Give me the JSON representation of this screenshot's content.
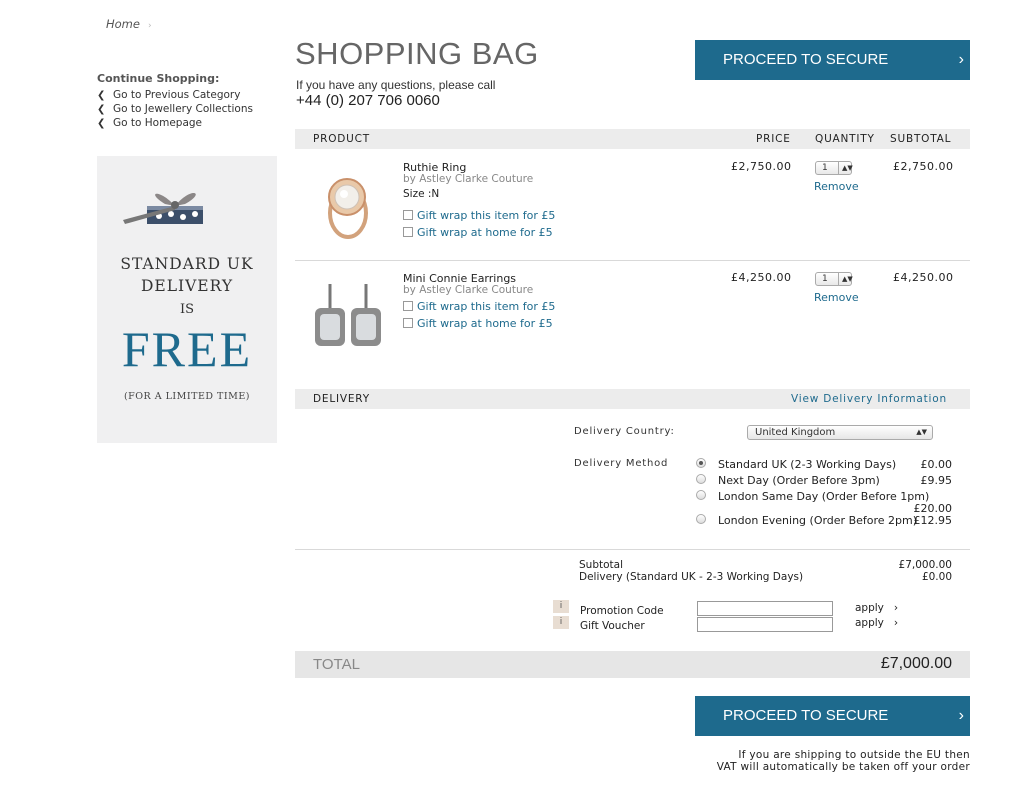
{
  "breadcrumb": {
    "home": "Home",
    "sep": "›"
  },
  "sidebar": {
    "title": "Continue Shopping:",
    "links": [
      "Go to Previous Category",
      "Go to Jewellery Collections",
      "Go to Homepage"
    ],
    "promo": {
      "line1": "STANDARD UK",
      "line2": "DELIVERY",
      "line3": "IS",
      "big": "FREE",
      "note": "(FOR A LIMITED TIME)",
      "image_icon": "gift-box-icon"
    }
  },
  "header": {
    "title": "SHOPPING BAG",
    "question": "If you have any questions, please call",
    "phone": "+44 (0) 207 706 0060",
    "checkout_label": "PROCEED TO SECURE CHECKOUT",
    "checkout_arrow": "›"
  },
  "table": {
    "headers": {
      "product": "PRODUCT",
      "price": "PRICE",
      "quantity": "QUANTITY",
      "subtotal": "SUBTOTAL"
    },
    "items": [
      {
        "name": "Ruthie Ring",
        "brand": "by Astley Clarke Couture",
        "size": "Size :N",
        "gift_item": "Gift wrap this item for £5",
        "gift_home": "Gift wrap at home for £5",
        "price": "£2,750.00",
        "qty": "1",
        "remove": "Remove",
        "subtotal": "£2,750.00"
      },
      {
        "name": "Mini Connie Earrings",
        "brand": "by Astley Clarke Couture",
        "gift_item": "Gift wrap this item for £5",
        "gift_home": "Gift wrap at home for £5",
        "price": "£4,250.00",
        "qty": "1",
        "remove": "Remove",
        "subtotal": "£4,250.00"
      }
    ]
  },
  "delivery": {
    "header": "DELIVERY",
    "info_link": "View Delivery Information",
    "country_label": "Delivery Country:",
    "country_value": "United Kingdom",
    "method_label": "Delivery Method",
    "options": [
      {
        "label": "Standard UK (2-3 Working Days)",
        "price": "£0.00",
        "selected": true
      },
      {
        "label": "Next Day (Order Before 3pm)",
        "price": "£9.95",
        "selected": false
      },
      {
        "label": "London Same Day (Order Before 1pm)",
        "price": "£20.00",
        "selected": false
      },
      {
        "label": "London Evening (Order Before 2pm)",
        "price": "£12.95",
        "selected": false
      }
    ]
  },
  "summary": {
    "subtotal_label": "Subtotal",
    "subtotal_value": "£7,000.00",
    "delivery_label": "Delivery (Standard UK - 2-3 Working Days)",
    "delivery_value": "£0.00",
    "promo_label": "Promotion Code",
    "voucher_label": "Gift Voucher",
    "apply": "apply",
    "apply_arrow": "›",
    "info": "i",
    "total_label": "TOTAL",
    "total_value": "£7,000.00"
  },
  "footer_note": {
    "line1": "If you are shipping to outside the EU then",
    "line2": "VAT will automatically be taken off your order"
  },
  "colors": {
    "accent": "#1e6a8d",
    "bar": "#ececec"
  }
}
